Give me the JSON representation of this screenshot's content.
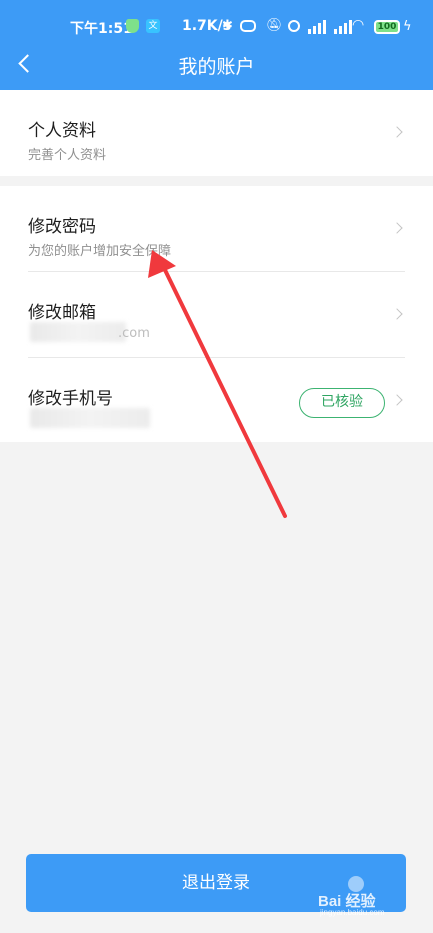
{
  "statusbar": {
    "time": "下午1:51",
    "speed": "1.7K/s",
    "battery": "100"
  },
  "header": {
    "title": "我的账户"
  },
  "profile": {
    "title": "个人资料",
    "subtitle": "完善个人资料"
  },
  "password": {
    "title": "修改密码",
    "subtitle": "为您的账户增加安全保障"
  },
  "email": {
    "title": "修改邮箱",
    "value_tail": ".com"
  },
  "phone": {
    "title": "修改手机号",
    "badge": "已核验"
  },
  "logout_label": "退出登录",
  "watermark": {
    "text": "Bai 经验",
    "url": "jingyan.baidu.com"
  },
  "colors": {
    "header": "#3d9bf6",
    "badge": "#3cb371",
    "annotation_arrow": "#f0393d"
  },
  "icons": [
    "shield-icon",
    "app-icon",
    "bluetooth-icon",
    "nfc-icon",
    "mute-icon",
    "alarm-icon",
    "signal-icon",
    "wifi-icon",
    "battery-icon",
    "back-icon",
    "chevron-right-icon"
  ]
}
